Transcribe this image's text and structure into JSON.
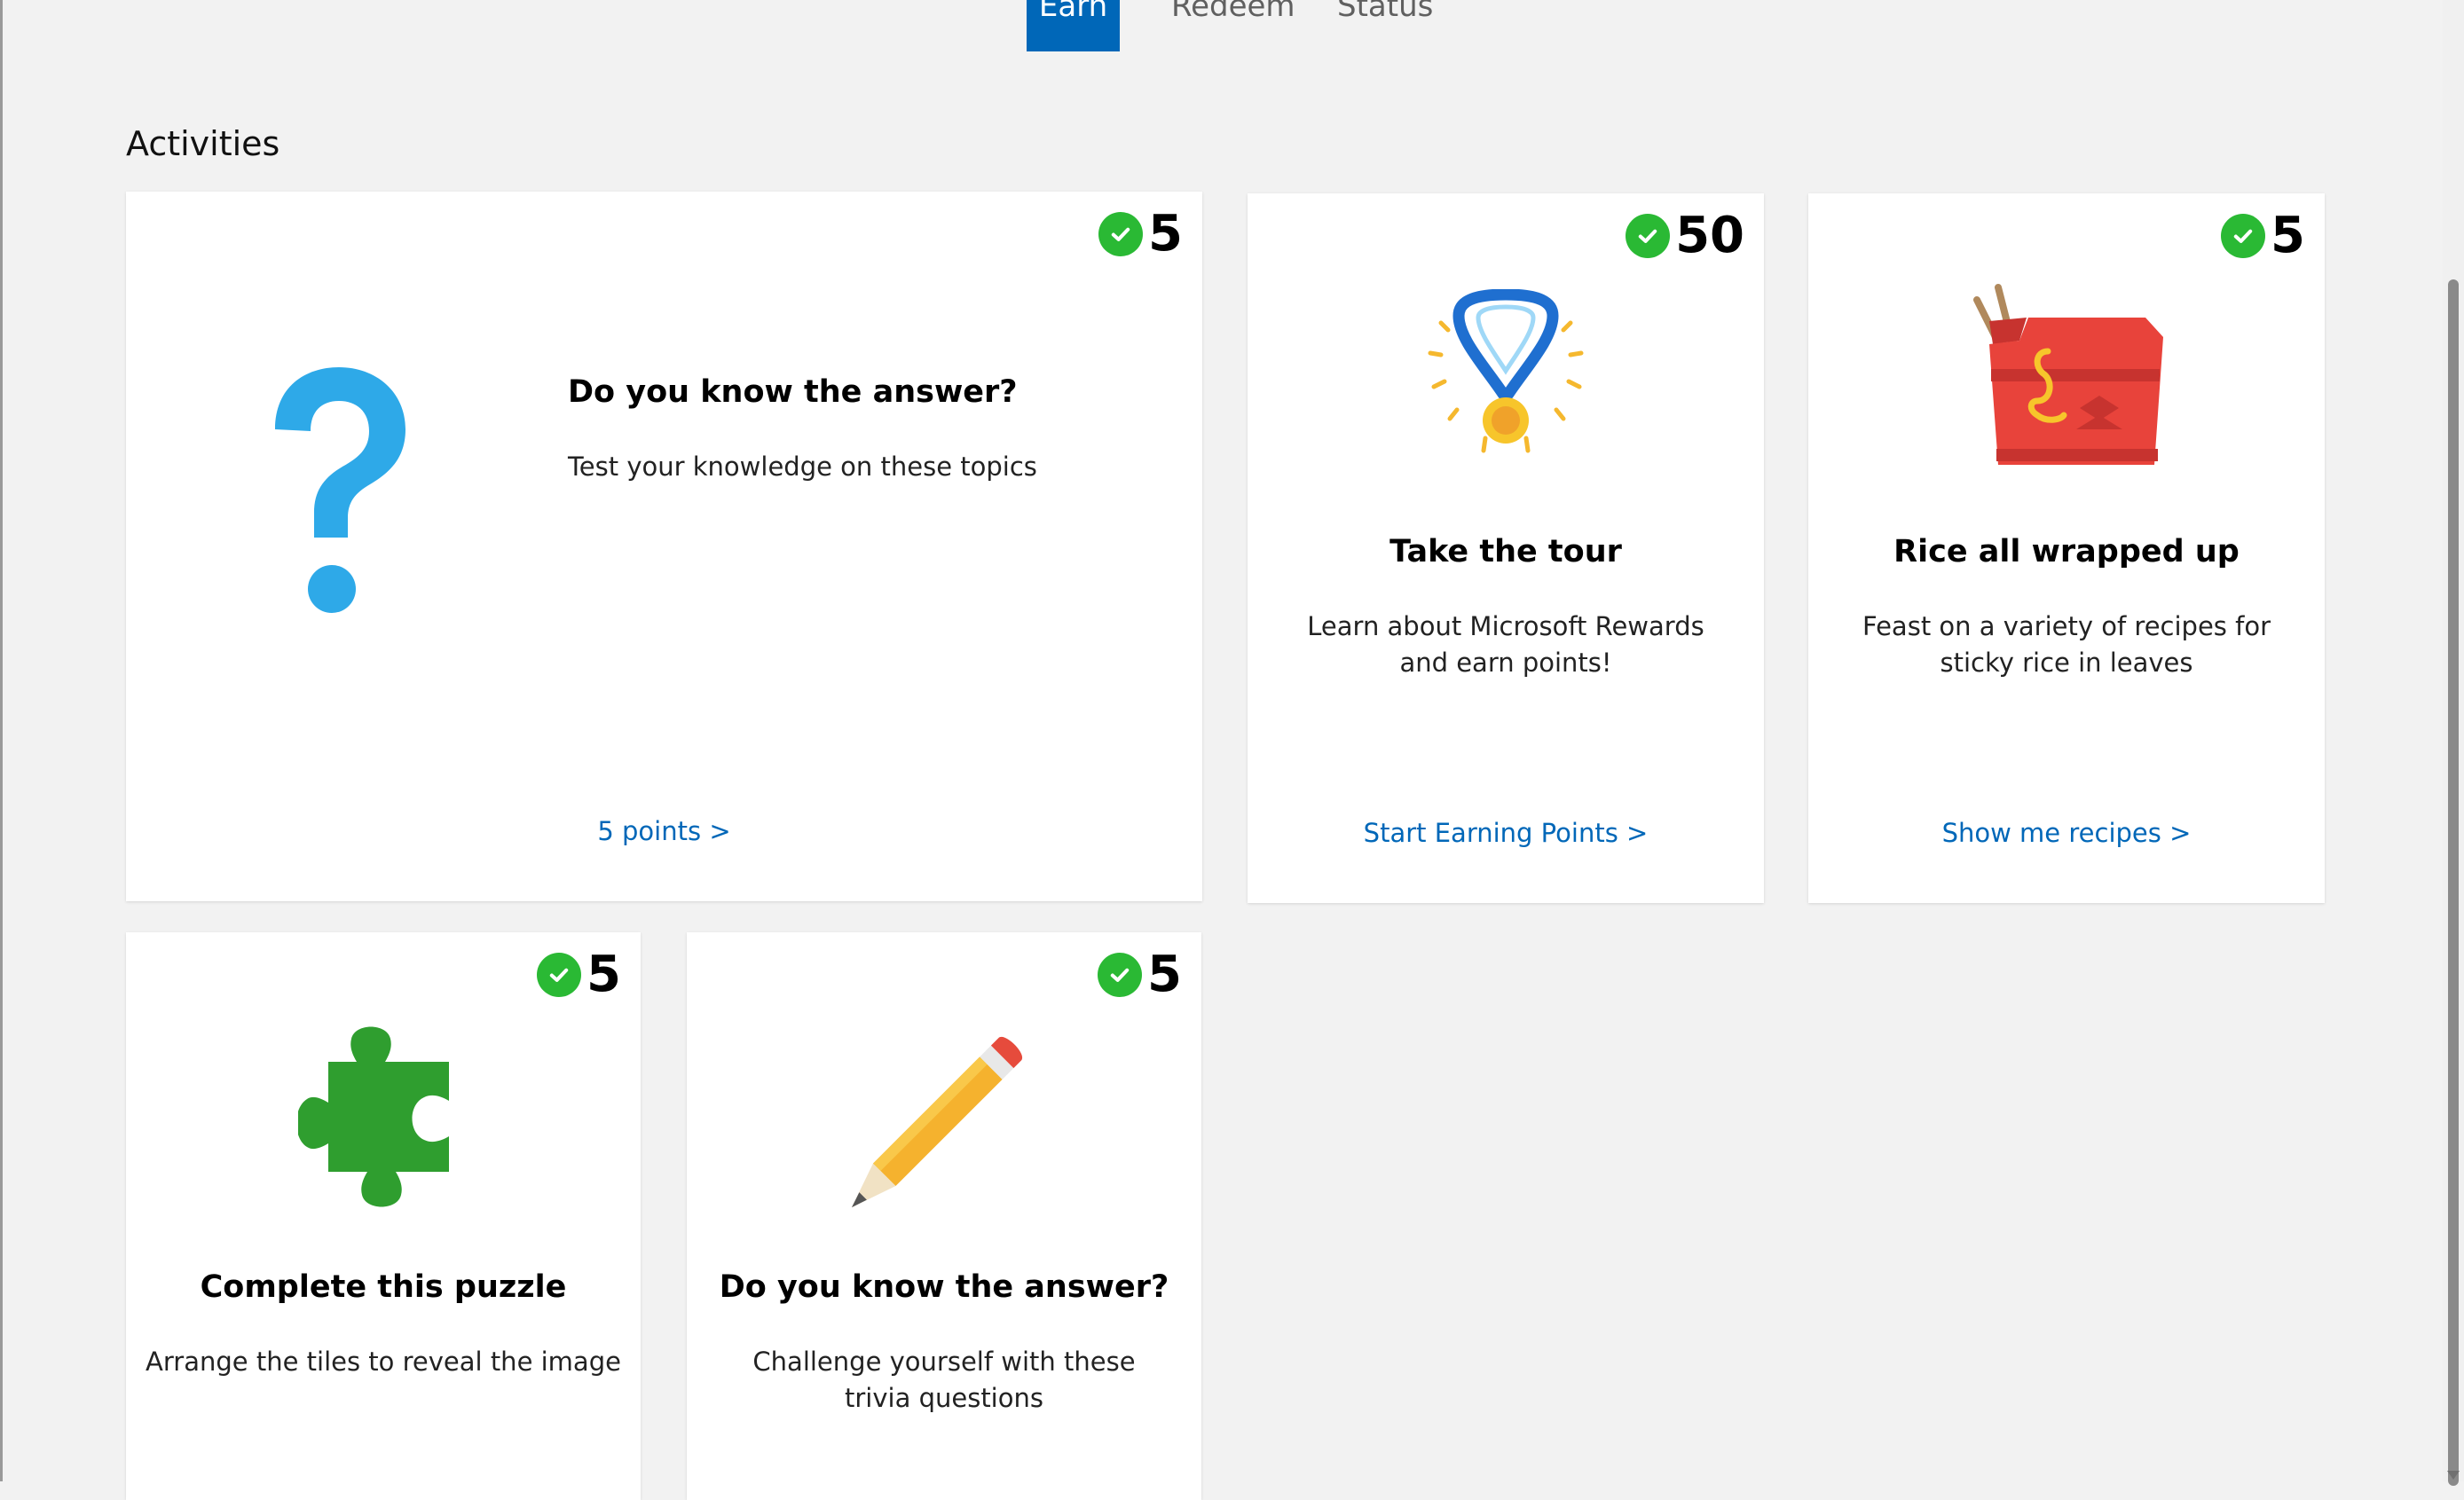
{
  "tabs": [
    {
      "label": "Earn",
      "active": true
    },
    {
      "label": "Redeem",
      "active": false
    },
    {
      "label": "Status",
      "active": false
    }
  ],
  "section_title": "Activities",
  "cards": [
    {
      "points": "5",
      "title": "Do you know the answer?",
      "description": "Test your knowledge on these topics",
      "link": "5 points >",
      "icon": "question-mark-icon"
    },
    {
      "points": "50",
      "title": "Take the tour",
      "description": "Learn about Microsoft Rewards and earn points!",
      "link": "Start Earning Points >",
      "icon": "medal-icon"
    },
    {
      "points": "5",
      "title": "Rice all wrapped up",
      "description": "Feast on a variety of recipes for sticky rice in leaves",
      "link": "Show me recipes >",
      "icon": "takeout-box-icon"
    },
    {
      "points": "5",
      "title": "Complete this puzzle",
      "description": "Arrange the tiles to reveal the image",
      "link": "",
      "icon": "puzzle-piece-icon"
    },
    {
      "points": "5",
      "title": "Do you know the answer?",
      "description": "Challenge yourself with these trivia questions",
      "link": "",
      "icon": "pencil-icon"
    }
  ],
  "colors": {
    "accent": "#0067b8",
    "check": "#2ab934"
  }
}
